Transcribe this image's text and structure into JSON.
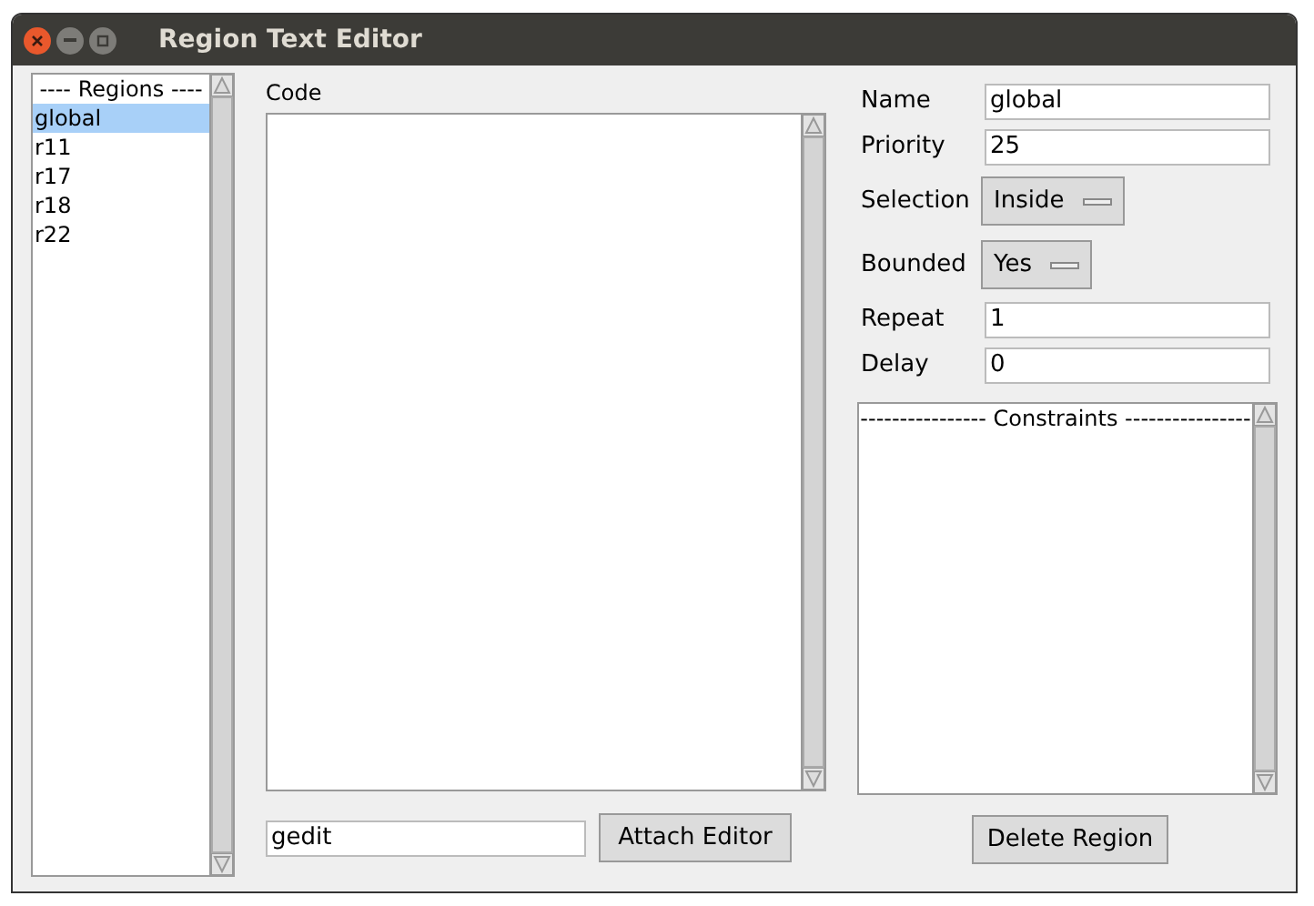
{
  "window": {
    "title": "Region Text Editor"
  },
  "regions": {
    "header": "---- Regions ----",
    "items": [
      {
        "label": "global",
        "selected": true
      },
      {
        "label": "r11",
        "selected": false
      },
      {
        "label": "r17",
        "selected": false
      },
      {
        "label": "r18",
        "selected": false
      },
      {
        "label": "r22",
        "selected": false
      }
    ]
  },
  "code": {
    "label": "Code"
  },
  "editor_command": {
    "value": "gedit"
  },
  "attach_button": "Attach Editor",
  "properties": [
    {
      "kind": "entry",
      "label": "Name",
      "value": "global"
    },
    {
      "kind": "entry",
      "label": "Priority",
      "value": "25"
    },
    {
      "kind": "menu",
      "label": "Selection",
      "value": "Inside"
    },
    {
      "kind": "menu",
      "label": "Bounded",
      "value": "Yes"
    },
    {
      "kind": "entry",
      "label": "Repeat",
      "value": "1"
    },
    {
      "kind": "entry",
      "label": "Delay",
      "value": "0"
    }
  ],
  "constraints": {
    "header": "---------------- Constraints ----------------"
  },
  "delete_button": "Delete Region"
}
